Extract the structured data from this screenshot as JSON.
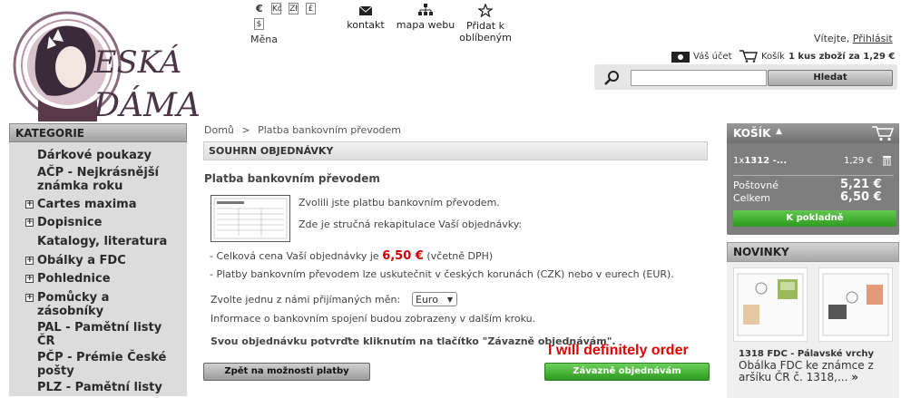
{
  "brand": {
    "logo_text": "ČESKÁ DÁMA"
  },
  "header": {
    "currency_label": "Měna",
    "currency_options": [
      "€",
      "Kč",
      "Zł",
      "£",
      "$"
    ],
    "links": [
      {
        "label": "kontakt"
      },
      {
        "label": "mapa webu"
      },
      {
        "label": "Přidat k oblíbeným"
      }
    ],
    "welcome": "Vítejte,",
    "login": "Přihlásit",
    "account": "Váš účet",
    "cart_prefix": "Košík",
    "cart_summary": "1 kus zboží za 1,29 €",
    "search_placeholder": "",
    "search_button": "Hledat"
  },
  "sidebar": {
    "title": "KATEGORIE",
    "items": [
      {
        "label": "Dárkové poukazy",
        "expandable": false
      },
      {
        "label": "AČP - Nejkrásnější známka roku",
        "expandable": false
      },
      {
        "label": "Cartes maxima",
        "expandable": true
      },
      {
        "label": "Dopisnice",
        "expandable": true
      },
      {
        "label": "Katalogy, literatura",
        "expandable": false
      },
      {
        "label": "Obálky a FDC",
        "expandable": true
      },
      {
        "label": "Pohlednice",
        "expandable": true
      },
      {
        "label": "Pomůcky a zásobníky",
        "expandable": true
      },
      {
        "label": "PAL - Pamětní listy ČR",
        "expandable": false
      },
      {
        "label": "PČP - Prémie České pošty",
        "expandable": false
      },
      {
        "label": "PLZ - Pamětní listy",
        "expandable": false
      }
    ]
  },
  "main": {
    "breadcrumb": [
      "Domů",
      ">",
      "Platba bankovním převodem"
    ],
    "section_title": "SOUHRN OBJEDNÁVKY",
    "payment_title": "Platba bankovním převodem",
    "chosen_text": "Zvolili jste platbu bankovním převodem.",
    "recap_text": "Zde je stručná rekapitulace Vaší objednávky:",
    "total_prefix": "- Celková cena Vaší objednávky je",
    "total_price": "6,50 €",
    "total_suffix": "(včetně DPH)",
    "currency_note": "- Platby bankovním převodem lze uskutečnit v českých korunách (CZK) nebo v eurech (EUR).",
    "choose_currency": "Zvolte jednu z námi přijímaných měn:",
    "currency_selected": "Euro",
    "bank_info": "Informace o bankovním spojení budou zobrazeny v dalším kroku.",
    "confirm_text": "Svou objednávku potvrďte kliknutím na tlačítko \"Závazně objednávám\".",
    "back_button": "Zpět na možnosti platby",
    "order_button": "Závazně objednávám",
    "annotation": "I will definitely order"
  },
  "cart_box": {
    "title": "KOŠÍK",
    "item_qty": "1x",
    "item_name": "1312 -...",
    "item_price": "1,29 €",
    "shipping_label": "Poštovné",
    "shipping_value": "5,21 €",
    "total_label": "Celkem",
    "total_value": "6,50 €",
    "checkout_button": "K pokladně"
  },
  "news": {
    "title": "NOVINKY",
    "item_title": "1318 FDC - Pálavské vrchy",
    "item_desc": "Obálka FDC ke známce z aršíku ČR č. 1318,...",
    "more": "»"
  },
  "colors": {
    "accent_red": "#cc0000",
    "button_green": "#2e9a1f",
    "panel_gray": "#7e7e7e"
  }
}
